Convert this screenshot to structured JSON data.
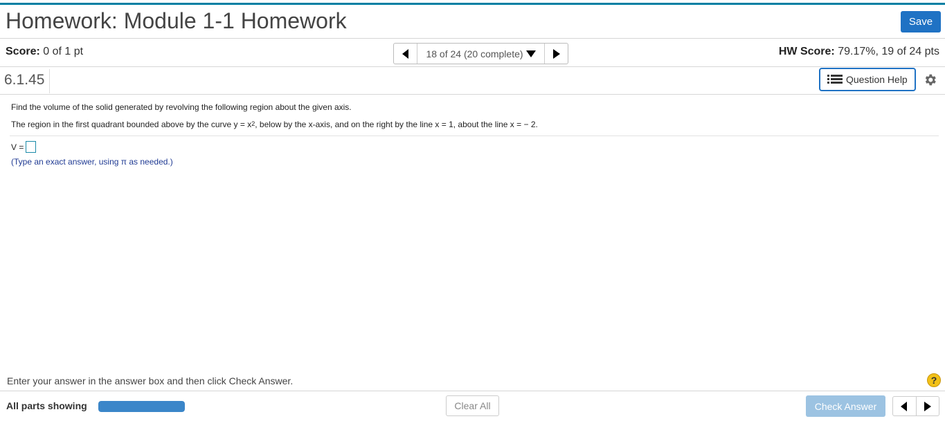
{
  "header": {
    "title": "Homework: Module 1-1 Homework",
    "save_label": "Save"
  },
  "status": {
    "score_label": "Score:",
    "score_value": "0 of 1 pt",
    "hw_score_label": "HW Score:",
    "hw_score_value": "79.17%, 19 of 24 pts",
    "question_nav": "18 of 24 (20 complete)"
  },
  "question": {
    "number": "6.1.45",
    "help_label": "Question Help",
    "prompt": "Find the volume of the solid generated by revolving the following region about the given axis.",
    "region_part1": "The region in the first quadrant bounded above by the curve y = x",
    "region_exp": "2",
    "region_part2": ", below by the x-axis, and on the right by the line x = 1, about the line x = − 2.",
    "answer_label": "V =",
    "answer_value": "",
    "hint": "(Type an exact answer, using π as needed.)"
  },
  "footer": {
    "instruction": "Enter your answer in the answer box and then click Check Answer.",
    "parts_label": "All parts showing",
    "progress_fraction": 1.0,
    "clear_label": "Clear All",
    "check_label": "Check Answer"
  },
  "colors": {
    "accent": "#1f72c4",
    "top_bar": "#007fa3",
    "hint_text": "#1f3a93",
    "help_badge": "#f2c118"
  }
}
